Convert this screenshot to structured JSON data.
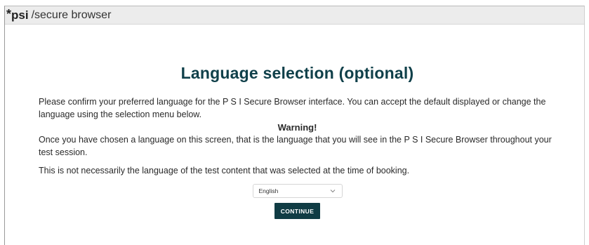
{
  "titlebar": {
    "star": "*",
    "brand": "psi",
    "app_name": "/secure browser"
  },
  "page": {
    "title": "Language selection (optional)",
    "intro": "Please confirm your preferred language for the P S I Secure Browser interface. You can accept the default displayed or change the language using the selection menu below.",
    "warning_label": "Warning!",
    "warning_text": "Once you have chosen a language on this screen, that is the language that you will see in the P S I Secure Browser throughout your test session.",
    "note": "This is not necessarily the language of the test content that was selected at the time of booking."
  },
  "language_select": {
    "selected": "English",
    "icon": "chevron-down-icon"
  },
  "actions": {
    "continue_label": "CONTINUE"
  },
  "colors": {
    "title": "#10404a",
    "button_bg": "#103c44",
    "titlebar_bg": "#ececec"
  }
}
